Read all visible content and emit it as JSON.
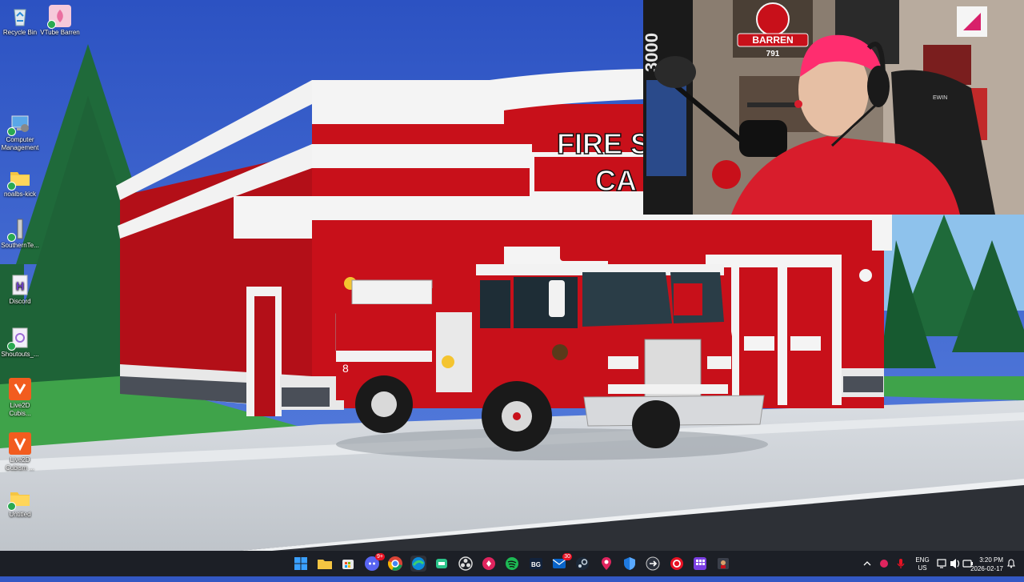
{
  "desktop": {
    "icons": [
      {
        "label": "Recycle Bin"
      },
      {
        "label": "VTube Barren"
      },
      {
        "label": "Computer Management"
      },
      {
        "label": "noalbs-kick"
      },
      {
        "label": "SouthernTe..."
      },
      {
        "label": "Discord"
      },
      {
        "label": "Shoutouts_..."
      },
      {
        "label": "Live2D Cubis..."
      },
      {
        "label": "Live2D Cubism ..."
      },
      {
        "label": "Untitled"
      }
    ]
  },
  "scene": {
    "sign_line1": "FIRE S",
    "sign_line2": "CA",
    "truck_number": "8"
  },
  "webcam": {
    "logo_text": "BARREN",
    "logo_number": "791",
    "banner_text": "3000",
    "chair_brand": "EWIN"
  },
  "taskbar": {
    "apps": [
      {
        "name": "start-button"
      },
      {
        "name": "file-explorer"
      },
      {
        "name": "microsoft-store"
      },
      {
        "name": "discord",
        "badge": "9+"
      },
      {
        "name": "chrome"
      },
      {
        "name": "edge"
      },
      {
        "name": "app-green"
      },
      {
        "name": "obs"
      },
      {
        "name": "app-pink"
      },
      {
        "name": "spotify"
      },
      {
        "name": "bg-app"
      },
      {
        "name": "outlook",
        "badge": "30"
      },
      {
        "name": "steam"
      },
      {
        "name": "maps"
      },
      {
        "name": "defender"
      },
      {
        "name": "app-arrow"
      },
      {
        "name": "app-red"
      },
      {
        "name": "app-purple"
      },
      {
        "name": "app-dark"
      }
    ],
    "bg_label": "BG",
    "tray": {
      "language": "ENG",
      "region": "US",
      "time": "3:20 PM",
      "date": "2026-02-17"
    }
  },
  "colors": {
    "sky": "#3458c6",
    "station_red": "#c8101a",
    "taskbar": "#1c1f26",
    "hoodie": "#d81d2c"
  }
}
